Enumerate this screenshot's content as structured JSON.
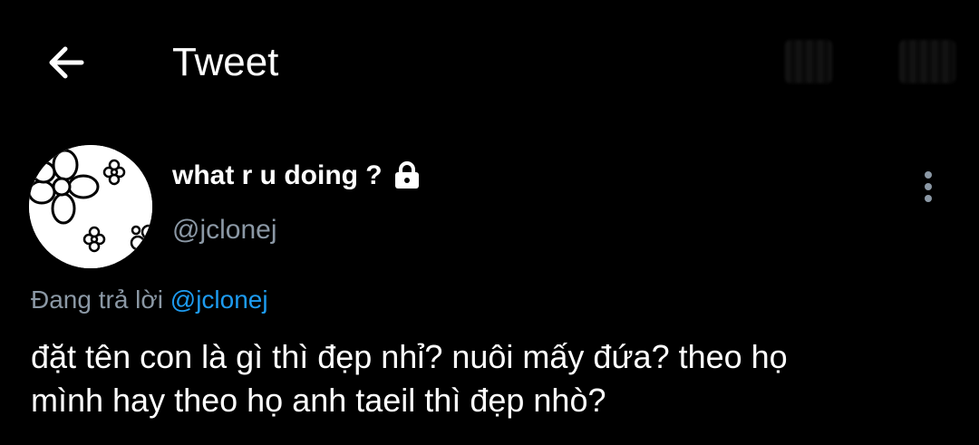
{
  "header": {
    "title": "Tweet",
    "back_icon": "arrow-left-icon"
  },
  "tweet": {
    "author": {
      "display_name": "what r u doing ?",
      "handle": "@jclonej",
      "protected_icon": "lock-icon"
    },
    "reply": {
      "prefix": "Đang trả lời",
      "mention": "@jclonej"
    },
    "text_line1": "đặt tên con là gì thì đẹp nhỉ? nuôi mấy đứa? theo họ",
    "text_line2": "mình hay theo họ anh taeil thì đẹp nhò?",
    "more_icon": "more-vertical-icon"
  },
  "colors": {
    "background": "#000000",
    "text_primary": "#ffffff",
    "text_secondary": "#8b98a5",
    "link": "#1d9bf0"
  }
}
